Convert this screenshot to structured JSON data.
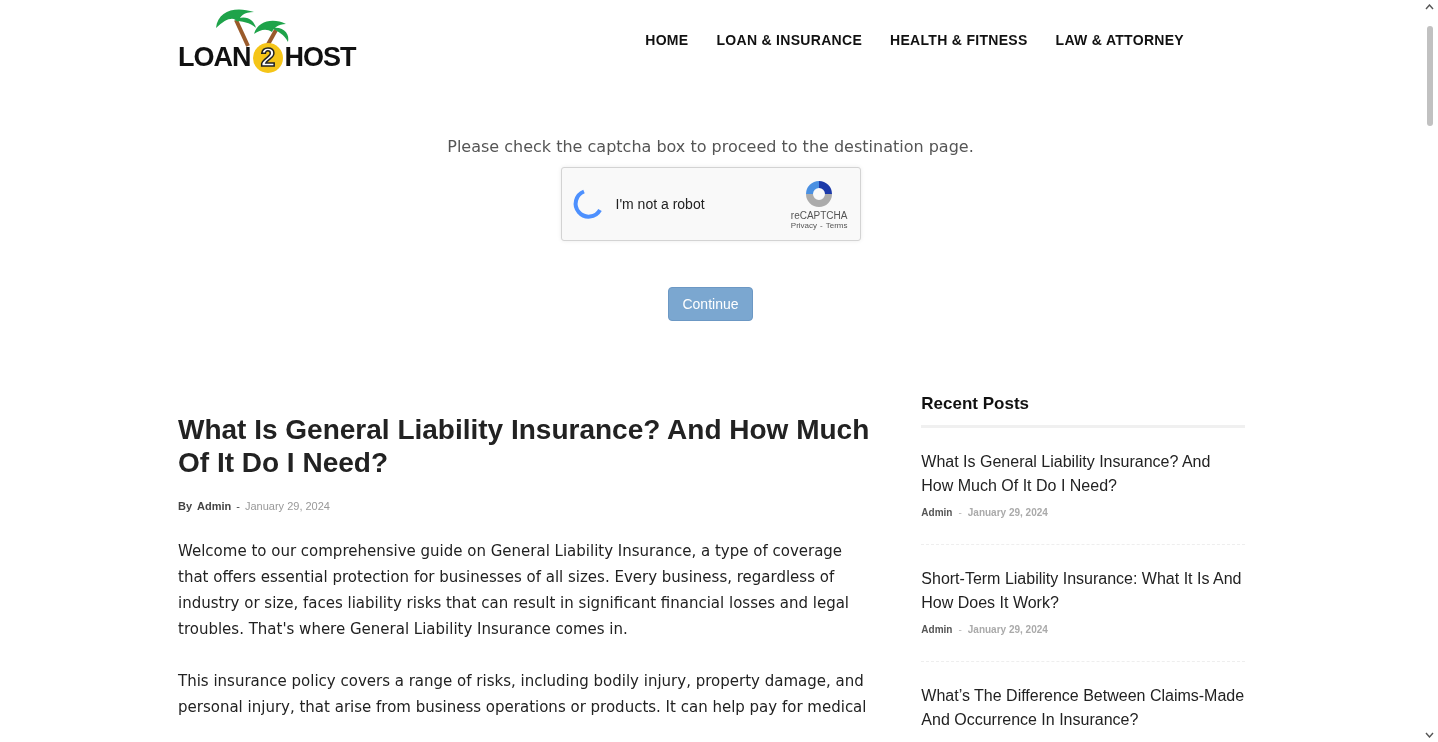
{
  "logo": {
    "word_1": "LOAN",
    "badge": "2",
    "word_2": "HOST"
  },
  "nav": [
    "HOME",
    "LOAN & INSURANCE",
    "HEALTH & FITNESS",
    "LAW & ATTORNEY"
  ],
  "gate": {
    "prompt": "Please check the captcha box to proceed to the destination page.",
    "captcha": {
      "label": "I'm not a robot",
      "checked": false,
      "brand": "reCAPTCHA",
      "privacy": "Privacy",
      "separator": "-",
      "terms": "Terms"
    },
    "button": {
      "label": "Continue",
      "disabled": true
    }
  },
  "article": {
    "title": "What Is General Liability Insurance? And How Much Of It Do I Need?",
    "by": "By",
    "author": "Admin",
    "separator": "-",
    "date": "January 29, 2024",
    "paragraphs": [
      "Welcome to our comprehensive guide on General Liability Insurance, a type of coverage that offers essential protection for businesses of all sizes. Every business, regardless of industry or size, faces liability risks that can result in significant financial losses and legal troubles. That's where General Liability Insurance comes in.",
      "This insurance policy covers a range of risks, including bodily injury, property damage, and personal injury, that arise from business operations or products. It can help pay for medical"
    ]
  },
  "sidebar": {
    "title": "Recent Posts",
    "posts": [
      {
        "title": "What Is General Liability Insurance? And How Much Of It Do I Need?",
        "author": "Admin",
        "separator": "-",
        "date": "January 29, 2024"
      },
      {
        "title": "Short-Term Liability Insurance: What It Is And How Does It Work?",
        "author": "Admin",
        "separator": "-",
        "date": "January 29, 2024"
      },
      {
        "title": "What’s The Difference Between Claims-Made And Occurrence In Insurance?"
      }
    ]
  }
}
